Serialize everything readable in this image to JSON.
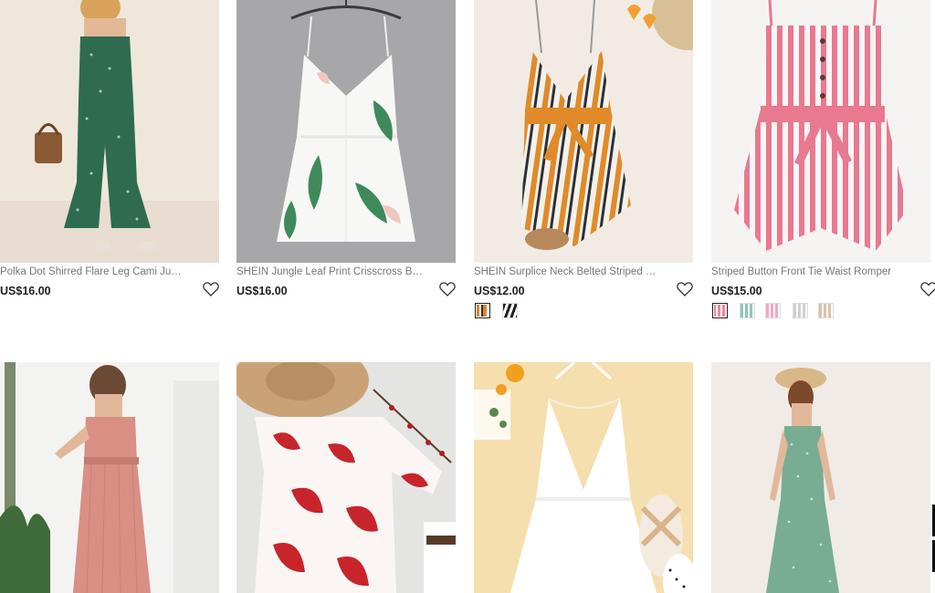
{
  "products": [
    {
      "name": "Polka Dot Shirred Flare Leg Cami Jumpsuit",
      "price": "US$16.00",
      "image": "green-polka-dot-jumpsuit",
      "swatches": []
    },
    {
      "name": "SHEIN Jungle Leaf Print Crisscross Back Pr...",
      "price": "US$16.00",
      "image": "white-leaf-print-romper",
      "swatches": []
    },
    {
      "name": "SHEIN Surplice Neck Belted Striped Slip Ro...",
      "price": "US$12.00",
      "image": "orange-striped-belted-romper",
      "swatches": [
        {
          "color": "#d9862f",
          "pattern": "stripe-orange",
          "active": true
        },
        {
          "color": "#222222",
          "pattern": "stripe-black",
          "active": false
        }
      ]
    },
    {
      "name": "Striped Button Front Tie Waist Romper",
      "price": "US$15.00",
      "image": "pink-striped-romper",
      "swatches": [
        {
          "color": "#e88aa0",
          "pattern": "stripe-pink",
          "active": true
        },
        {
          "color": "#8fc5b3",
          "pattern": "stripe-mint",
          "active": false
        },
        {
          "color": "#f2a9c0",
          "pattern": "stripe-lightpink",
          "active": false
        },
        {
          "color": "#cfcfcf",
          "pattern": "stripe-grey",
          "active": false
        },
        {
          "color": "#d8c4a8",
          "pattern": "stripe-beige",
          "active": false
        }
      ]
    },
    {
      "name": "",
      "price": "",
      "image": "pink-tube-wide-leg-jumpsuit",
      "swatches": []
    },
    {
      "name": "",
      "price": "",
      "image": "red-floral-off-shoulder-romper",
      "swatches": []
    },
    {
      "name": "",
      "price": "",
      "image": "white-halter-romper",
      "swatches": []
    },
    {
      "name": "",
      "price": "",
      "image": "green-tube-jumpsuit",
      "swatches": []
    }
  ],
  "icons": {
    "wishlist": "heart-outline-icon"
  }
}
